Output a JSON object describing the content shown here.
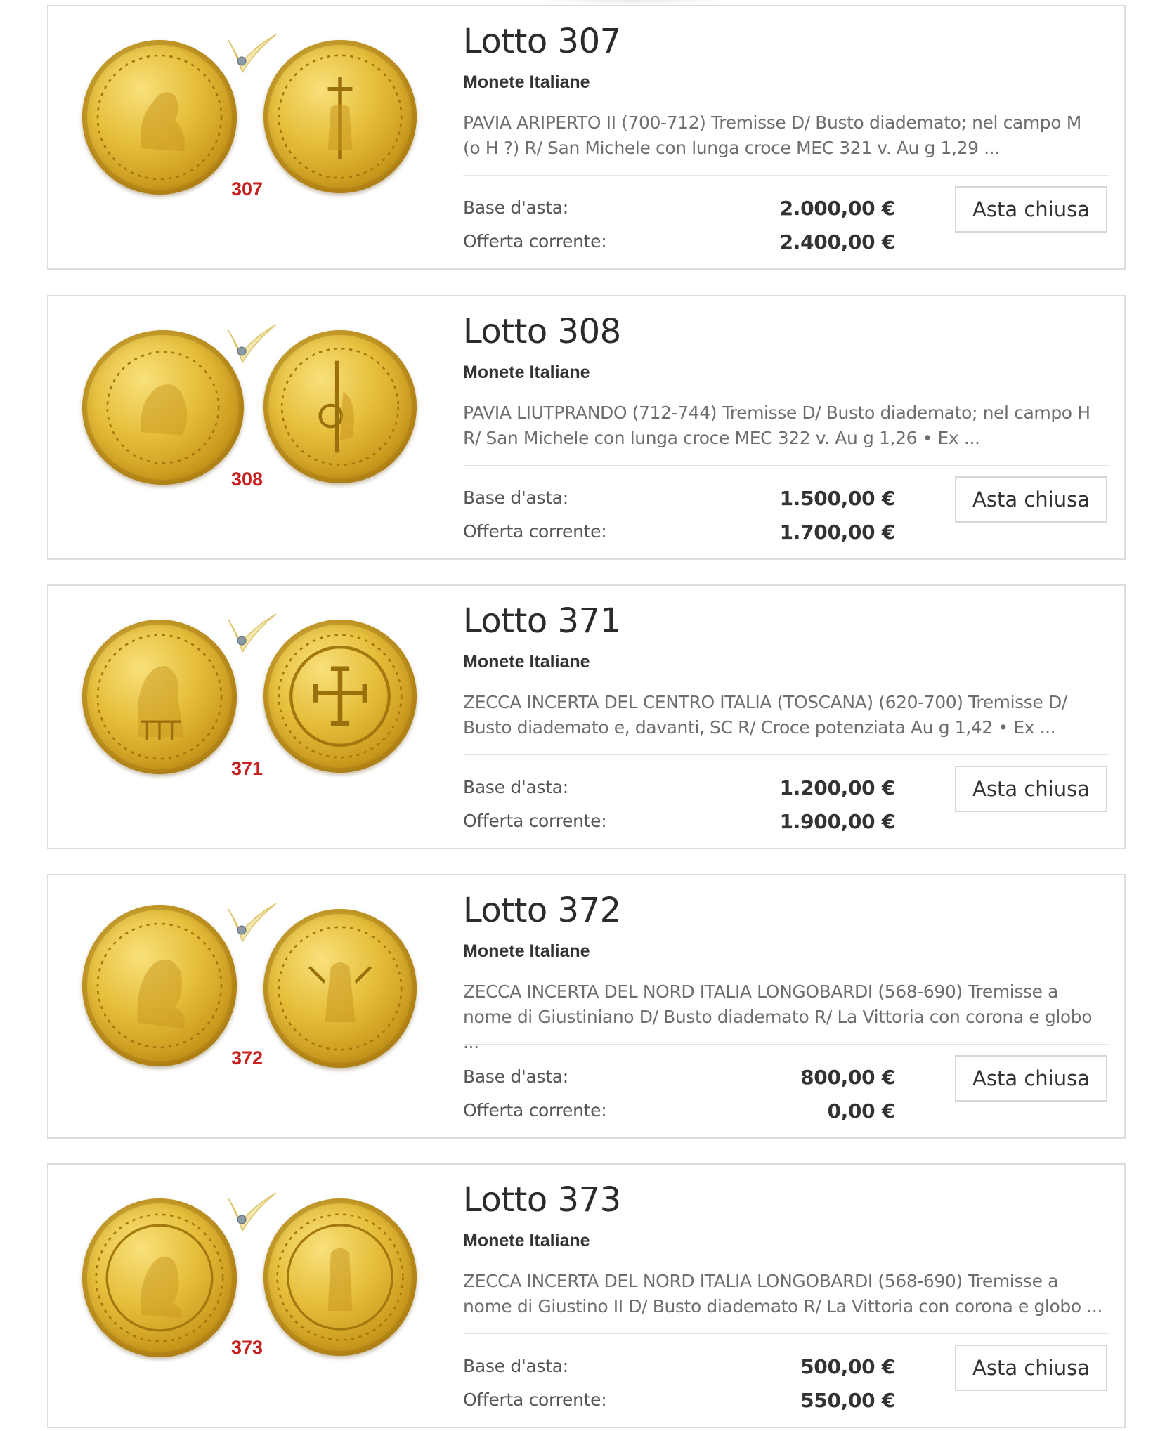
{
  "lots": [
    {
      "title": "Lotto 307",
      "number": "307",
      "category": "Monete Italiane",
      "description": "PAVIA ARIPERTO II (700-712) Tremisse D/ Busto diademato; nel campo M (o H ?) R/ San Michele con lunga croce MEC 321 v. Au g 1,29 ...",
      "base_label": "Base d'asta:",
      "base_value": "2.000,00 €",
      "offer_label": "Offerta corrente:",
      "offer_value": "2.400,00 €",
      "status_label": "Asta chiusa"
    },
    {
      "title": "Lotto 308",
      "number": "308",
      "category": "Monete Italiane",
      "description": "PAVIA LIUTPRANDO (712-744) Tremisse D/ Busto diademato; nel campo H R/ San Michele con lunga croce MEC 322 v. Au g 1,26 • Ex ...",
      "base_label": "Base d'asta:",
      "base_value": "1.500,00 €",
      "offer_label": "Offerta corrente:",
      "offer_value": "1.700,00 €",
      "status_label": "Asta chiusa"
    },
    {
      "title": "Lotto 371",
      "number": "371",
      "category": "Monete Italiane",
      "description": "ZECCA INCERTA DEL CENTRO ITALIA (TOSCANA) (620-700) Tremisse D/ Busto diademato e, davanti, SC R/ Croce potenziata Au g 1,42 • Ex ...",
      "base_label": "Base d'asta:",
      "base_value": "1.200,00 €",
      "offer_label": "Offerta corrente:",
      "offer_value": "1.900,00 €",
      "status_label": "Asta chiusa"
    },
    {
      "title": "Lotto 372",
      "number": "372",
      "category": "Monete Italiane",
      "description": "ZECCA INCERTA DEL NORD ITALIA LONGOBARDI (568-690) Tremisse a nome di Giustiniano D/ Busto diademato R/ La Vittoria con corona e globo ...",
      "base_label": "Base d'asta:",
      "base_value": "800,00 €",
      "offer_label": "Offerta corrente:",
      "offer_value": "0,00 €",
      "status_label": "Asta chiusa"
    },
    {
      "title": "Lotto 373",
      "number": "373",
      "category": "Monete Italiane",
      "description": "ZECCA INCERTA DEL NORD ITALIA LONGOBARDI (568-690) Tremisse a nome di Giustino II D/ Busto diademato R/ La Vittoria con corona e globo ...",
      "base_label": "Base d'asta:",
      "base_value": "500,00 €",
      "offer_label": "Offerta corrente:",
      "offer_value": "550,00 €",
      "status_label": "Asta chiusa"
    }
  ],
  "colors": {
    "lot_tag": "#c8201e",
    "coin_gold": "#e6bf3c",
    "border": "#dcdcdc"
  }
}
